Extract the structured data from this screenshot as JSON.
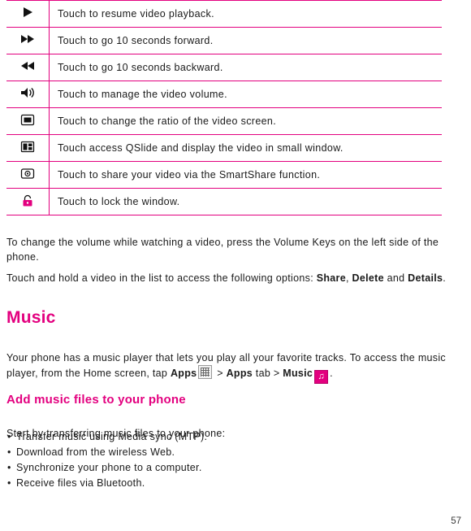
{
  "table": {
    "rows": [
      {
        "icon": "play-icon",
        "description": "Touch to resume video playback."
      },
      {
        "icon": "fast-forward-icon",
        "description": "Touch to go 10 seconds forward."
      },
      {
        "icon": "rewind-icon",
        "description": "Touch to go 10 seconds backward."
      },
      {
        "icon": "volume-icon",
        "description": "Touch to manage the video volume."
      },
      {
        "icon": "screen-ratio-icon",
        "description": "Touch to change the ratio of the video screen."
      },
      {
        "icon": "qslide-icon",
        "description": "Touch access QSlide and display the video in small window."
      },
      {
        "icon": "smartshare-icon",
        "description": "Touch to share your video via the SmartShare function."
      },
      {
        "icon": "lock-icon",
        "description": "Touch to lock the window."
      }
    ]
  },
  "body": {
    "paragraph1": "To change the volume while watching a video, press the Volume Keys on the left side of the phone.",
    "paragraph2_a": "Touch and hold a video in the list to access the following options: ",
    "paragraph2_b1": "Share",
    "paragraph2_sep": ", ",
    "paragraph2_b2": "Delete",
    "paragraph2_c": " and ",
    "paragraph2_b3": "Details",
    "paragraph2_d": ".",
    "section_title": "Music",
    "paragraph3_a": "Your phone has a music player that lets you play all your favorite tracks. To access the music player, from the Home screen, tap ",
    "paragraph3_b1": "Apps",
    "paragraph3_mid": " > ",
    "paragraph3_b2": "Apps",
    "paragraph3_tab": " tab > ",
    "paragraph3_b3": "Music",
    "paragraph3_end": ".",
    "subsection_title": "Add music files to your phone",
    "paragraph4": "Start by transferring music files to your phone:",
    "bullets": [
      "Transfer music using Media sync (MTP).",
      "Download from the wireless Web.",
      "Synchronize your phone to a computer.",
      "Receive files via Bluetooth."
    ]
  },
  "footer": {
    "page_number": "57"
  },
  "colors": {
    "accent": "#e3007f",
    "text": "#1a1a1a"
  }
}
